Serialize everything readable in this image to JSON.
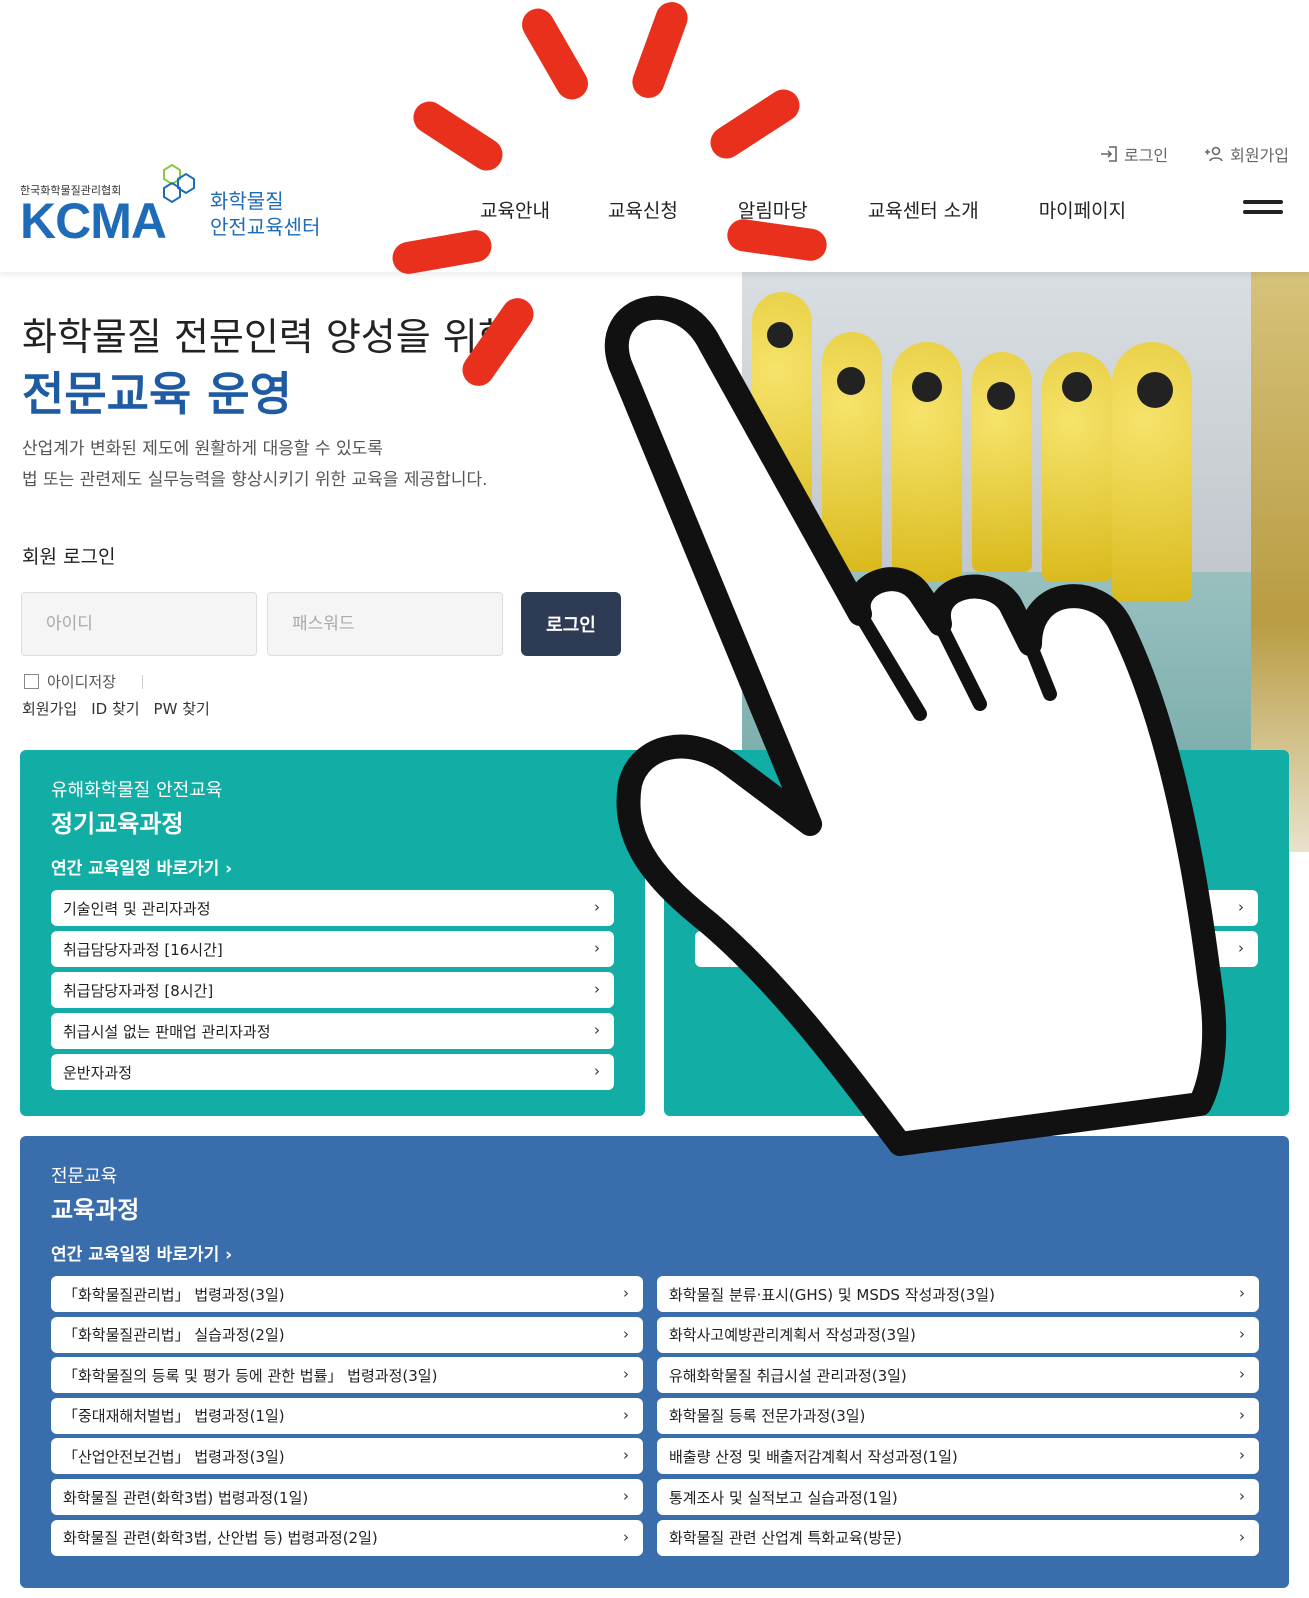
{
  "header": {
    "util": {
      "login_label": "로그인",
      "join_label": "회원가입"
    },
    "logo": {
      "org_name": "한국화학물질관리협회",
      "brand": "KCMA",
      "center_line1": "화학물질",
      "center_line2": "안전교육센터"
    },
    "nav": [
      "교육안내",
      "교육신청",
      "알림마당",
      "교육센터 소개",
      "마이페이지"
    ]
  },
  "hero": {
    "title_line1": "화학물질 전문인력 양성을 위한",
    "title_line2": "전문교육 운영",
    "desc_line1": "산업계가 변화된 제도에 원활하게 대응할 수 있도록",
    "desc_line2": "법 또는 관련제도 실무능력을 향상시키기 위한 교육을 제공합니다."
  },
  "login": {
    "title": "회원 로그인",
    "id_placeholder": "아이디",
    "pw_placeholder": "패스워드",
    "button": "로그인",
    "save_id": "아이디저장",
    "links": [
      "회원가입",
      "ID 찾기",
      "PW 찾기"
    ]
  },
  "regular": {
    "sub": "유해화학물질 안전교육",
    "title": "정기교육과정",
    "link": "연간 교육일정 바로가기",
    "courses": [
      "기술인력 및 관리자과정",
      "취급담당자과정 [16시간]",
      "취급담당자과정 [8시간]",
      "취급시설 없는 판매업 관리자과정",
      "운반자과정"
    ]
  },
  "professional": {
    "sub": "전문교육",
    "title": "교육과정",
    "link": "연간 교육일정 바로가기",
    "left_courses": [
      "「화학물질관리법」 법령과정(3일)",
      "「화학물질관리법」 실습과정(2일)",
      "「화학물질의 등록 및 평가 등에 관한 법률」 법령과정(3일)",
      "「중대재해처벌법」 법령과정(1일)",
      "「산업안전보건법」 법령과정(3일)",
      "화학물질 관련(화학3법) 법령과정(1일)",
      "화학물질 관련(화학3법, 산안법 등) 법령과정(2일)"
    ],
    "right_courses": [
      "화학물질 분류·표시(GHS) 및 MSDS 작성과정(3일)",
      "화학사고예방관리계획서 작성과정(3일)",
      "유해화학물질 취급시설 관리과정(3일)",
      "화학물질 등록 전문가과정(3일)",
      "배출량 산정 및 배출저감계획서 작성과정(1일)",
      "통계조사 및 실적보고 실습과정(1일)",
      "화학물질 관련 산업계 특화교육(방문)"
    ]
  },
  "colors": {
    "teal": "#12ada5",
    "blue": "#3a6dab",
    "navy_button": "#2e3b55",
    "ray_red": "#e8301d"
  },
  "icons": [
    "login-icon",
    "join-icon",
    "hamburger-menu-icon",
    "chevron-right-icon",
    "pointing-hand-icon"
  ]
}
